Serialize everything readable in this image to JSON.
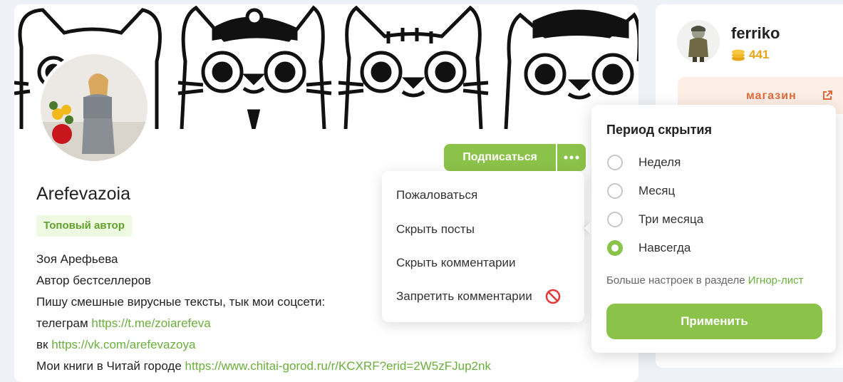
{
  "profile": {
    "username": "Arefevazoia",
    "badge": "Топовый автор",
    "subscribe_label": "Подписаться",
    "bio": {
      "line1": "Зоя Арефьева",
      "line2": "Автор бестселлеров",
      "line3": "Пишу смешные вирусные тексты, тык мои соцсети:",
      "telegram_prefix": "телеграм",
      "telegram_link": "https://t.me/zoiarefeva",
      "vk_prefix": "вк",
      "vk_link": "https://vk.com/arefevazoya",
      "books_prefix": "Мои книги в Читай городе",
      "books_link": "https://www.chitai-gorod.ru/r/KCXRF?erid=2W5zFJup2nk"
    }
  },
  "menu": {
    "items": [
      {
        "label": "Пожаловаться"
      },
      {
        "label": "Скрыть посты"
      },
      {
        "label": "Скрыть комментарии"
      },
      {
        "label": "Запретить комментарии",
        "icon": "ban-icon"
      }
    ]
  },
  "sidebar": {
    "user_name": "ferriko",
    "coins": "441",
    "shop_label": "магазин"
  },
  "hide_popup": {
    "title": "Период скрытия",
    "options": [
      {
        "label": "Неделя",
        "checked": false
      },
      {
        "label": "Месяц",
        "checked": false
      },
      {
        "label": "Три месяца",
        "checked": false
      },
      {
        "label": "Навсегда",
        "checked": true
      }
    ],
    "note_prefix": "Больше настроек в разделе",
    "note_link": "Игнор-лист",
    "apply_label": "Применить"
  },
  "colors": {
    "accent_green": "#8bc34a",
    "link_green": "#6aaf3c",
    "shop_orange": "#e06a3c",
    "coin_gold": "#e8a317",
    "ban_red": "#e53935"
  }
}
